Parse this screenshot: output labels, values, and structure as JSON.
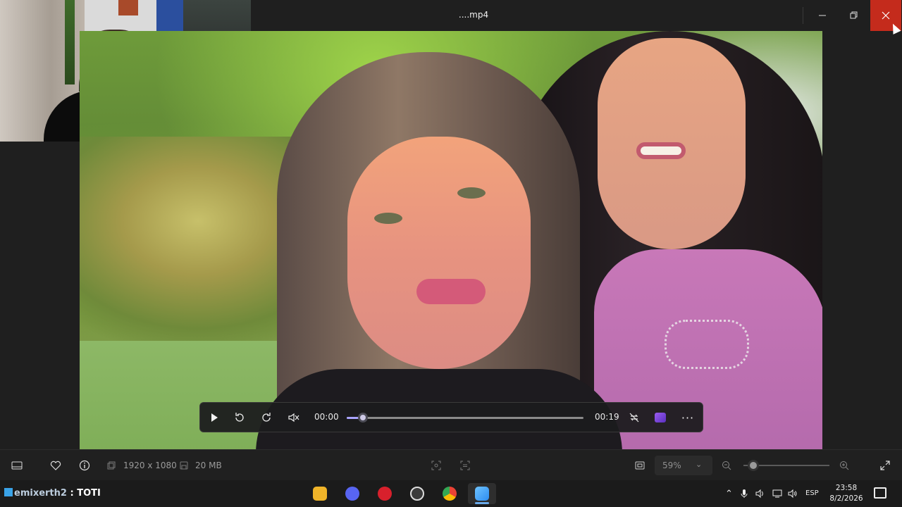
{
  "window": {
    "title": "....mp4",
    "minimize_icon": "minimize-icon",
    "maximize_icon": "restore-icon",
    "close_icon": "close-icon",
    "extensions": [
      {
        "name": "copilot-icon",
        "color": "#d66aa0"
      },
      {
        "name": "photos-edit-icon",
        "color": "#3a86e8"
      },
      {
        "name": "designer-icon",
        "color": "#7b3fcf"
      },
      {
        "name": "clipchamp-icon",
        "color": "#8a4bd8"
      },
      {
        "name": "onedrive-off-icon",
        "color": "#3a7bd5"
      }
    ]
  },
  "player": {
    "current_time": "00:00",
    "duration": "00:19",
    "progress": 0.05,
    "buttons": [
      "play-icon",
      "rewind-10-icon",
      "forward-30-icon",
      "mute-icon",
      "repeat-off-icon",
      "clipchamp-icon",
      "more-icon"
    ]
  },
  "info_bar": {
    "resolution": "1920 x 1080",
    "file_size": "20 MB",
    "zoom": "59%",
    "zoom_level": 0.1
  },
  "taskbar": {
    "streamer_handle": "emixerth2",
    "streamer_suffix": " : TOTI",
    "apps": [
      {
        "name": "file-explorer-icon",
        "color": "#f0b429"
      },
      {
        "name": "discord-icon",
        "color": "#5865f2"
      },
      {
        "name": "app-red-icon",
        "color": "#d8202c"
      },
      {
        "name": "obs-icon",
        "color": "#3b3b3b"
      },
      {
        "name": "chrome-icon",
        "color": "#34a853"
      },
      {
        "name": "photos-icon",
        "color": "#2d8cf0"
      }
    ],
    "language": "ESP",
    "time": "23:58",
    "date": "8/2/2026"
  },
  "colors": {
    "accent": "#a9a3ff",
    "close": "#c42b1c"
  }
}
